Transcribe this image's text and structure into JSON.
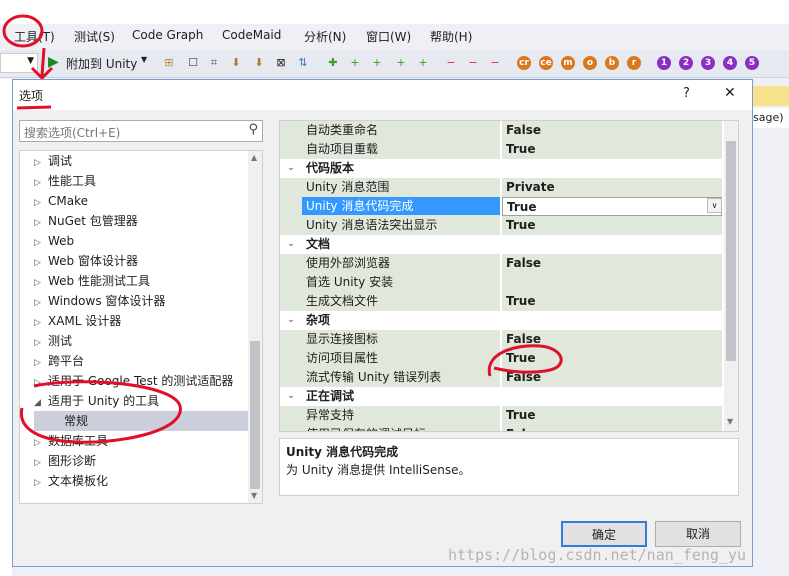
{
  "menubar": {
    "items": [
      "工具(T)",
      "测试(S)",
      "Code Graph",
      "CodeMaid",
      "分析(N)",
      "窗口(W)",
      "帮助(H)"
    ]
  },
  "toolbar": {
    "attach_label": "附加到 Unity",
    "circle_letters": [
      "cr",
      "ce",
      "m",
      "o",
      "b",
      "r"
    ],
    "circle_numbers": [
      "1",
      "2",
      "3",
      "4",
      "5"
    ]
  },
  "background": {
    "right_tab_text": "sage)"
  },
  "dialog": {
    "title": "选项",
    "help_label": "?",
    "close_label": "✕",
    "search_placeholder": "搜索选项(Ctrl+E)",
    "tree": [
      {
        "label": "调试",
        "expanded": false
      },
      {
        "label": "性能工具",
        "expanded": false
      },
      {
        "label": "CMake",
        "expanded": false
      },
      {
        "label": "NuGet 包管理器",
        "expanded": false
      },
      {
        "label": "Web",
        "expanded": false
      },
      {
        "label": "Web 窗体设计器",
        "expanded": false
      },
      {
        "label": "Web 性能测试工具",
        "expanded": false
      },
      {
        "label": "Windows 窗体设计器",
        "expanded": false
      },
      {
        "label": "XAML 设计器",
        "expanded": false
      },
      {
        "label": "测试",
        "expanded": false
      },
      {
        "label": "跨平台",
        "expanded": false
      },
      {
        "label": "适用于 Google Test 的测试适配器",
        "expanded": false
      },
      {
        "label": "适用于 Unity 的工具",
        "expanded": true
      },
      {
        "label": "常规",
        "child": true,
        "selected": true
      },
      {
        "label": "数据库工具",
        "expanded": false
      },
      {
        "label": "图形诊断",
        "expanded": false
      },
      {
        "label": "文本模板化",
        "expanded": false
      }
    ],
    "grid": [
      {
        "name": "自动类重命名",
        "value": "False"
      },
      {
        "name": "自动项目重载",
        "value": "True"
      },
      {
        "category": "代码版本"
      },
      {
        "name": "Unity 消息范围",
        "value": "Private"
      },
      {
        "name": "Unity 消息代码完成",
        "value": "True",
        "selected": true
      },
      {
        "name": "Unity 消息语法突出显示",
        "value": "True"
      },
      {
        "category": "文档"
      },
      {
        "name": "使用外部浏览器",
        "value": "False"
      },
      {
        "name": "首选 Unity 安装",
        "value": ""
      },
      {
        "name": "生成文档文件",
        "value": "True"
      },
      {
        "category": "杂项"
      },
      {
        "name": "显示连接图标",
        "value": "False"
      },
      {
        "name": "访问项目属性",
        "value": "True"
      },
      {
        "name": "流式传输 Unity 错误列表",
        "value": "False"
      },
      {
        "category": "正在调试"
      },
      {
        "name": "异常支持",
        "value": "True"
      },
      {
        "name": "使用已保存的调试目标",
        "value": "False"
      }
    ],
    "description": {
      "title": "Unity 消息代码完成",
      "text": "为 Unity 消息提供 IntelliSense。"
    },
    "ok_label": "确定",
    "cancel_label": "取消"
  },
  "watermark": "https://blog.csdn.net/nan_feng_yu"
}
